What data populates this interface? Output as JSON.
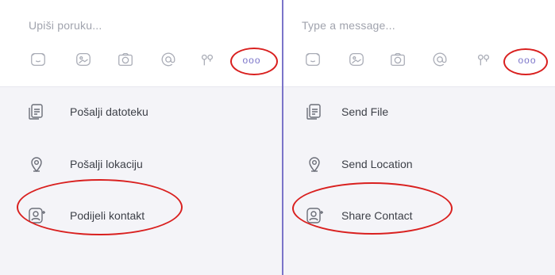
{
  "left": {
    "placeholder": "Upiši poruku...",
    "toolbar": [
      "sticker-icon",
      "image-icon",
      "camera-icon",
      "at-icon",
      "doodle-icon",
      "more-icon"
    ],
    "more_dots": "ooo",
    "menu": [
      {
        "label": "Pošalji datoteku",
        "icon": "file-icon"
      },
      {
        "label": "Pošalji lokaciju",
        "icon": "location-pin-icon"
      },
      {
        "label": "Podijeli kontakt",
        "icon": "contact-icon"
      }
    ]
  },
  "right": {
    "placeholder": "Type a message...",
    "toolbar": [
      "sticker-icon",
      "image-icon",
      "camera-icon",
      "at-icon",
      "doodle-icon",
      "more-icon"
    ],
    "more_dots": "ooo",
    "menu": [
      {
        "label": "Send File",
        "icon": "file-icon"
      },
      {
        "label": "Send Location",
        "icon": "location-pin-icon"
      },
      {
        "label": "Share Contact",
        "icon": "contact-icon"
      }
    ]
  },
  "colors": {
    "accent": "#7b74c9",
    "highlight": "#d9201f",
    "menu_bg": "#f4f4f8",
    "text": "#3d4048",
    "placeholder": "#a0a3ad"
  }
}
